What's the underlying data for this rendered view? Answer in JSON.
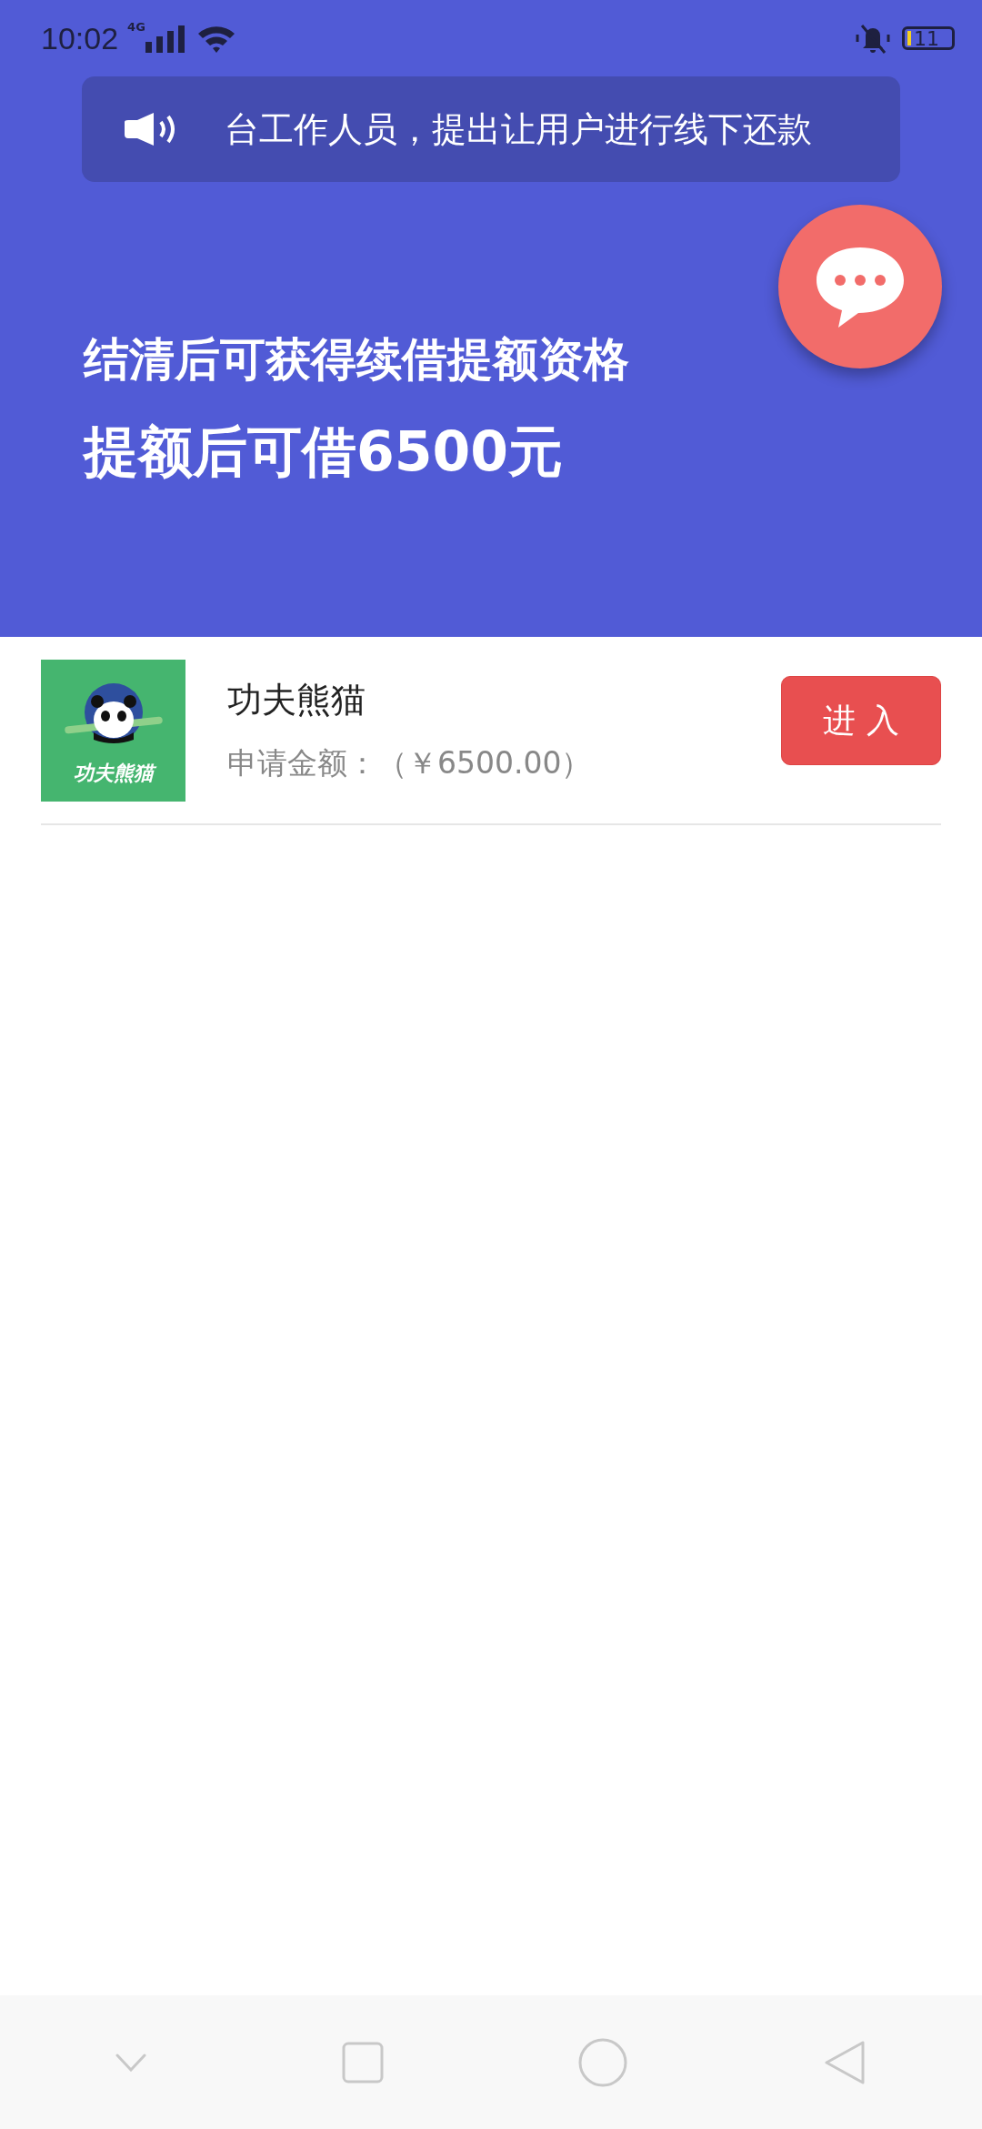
{
  "status_bar": {
    "time": "10:02",
    "network": "4G",
    "battery": "11"
  },
  "notice": {
    "text": "台工作人员，提出让用户进行线下还款"
  },
  "banner": {
    "line_1": "结清后可获得续借提额资格",
    "line_2": "提额后可借6500元"
  },
  "products": [
    {
      "name": "功夫熊猫",
      "logo_text": "功夫熊猫",
      "amount": "申请金额：（￥6500.00）",
      "button": "进 入"
    }
  ]
}
